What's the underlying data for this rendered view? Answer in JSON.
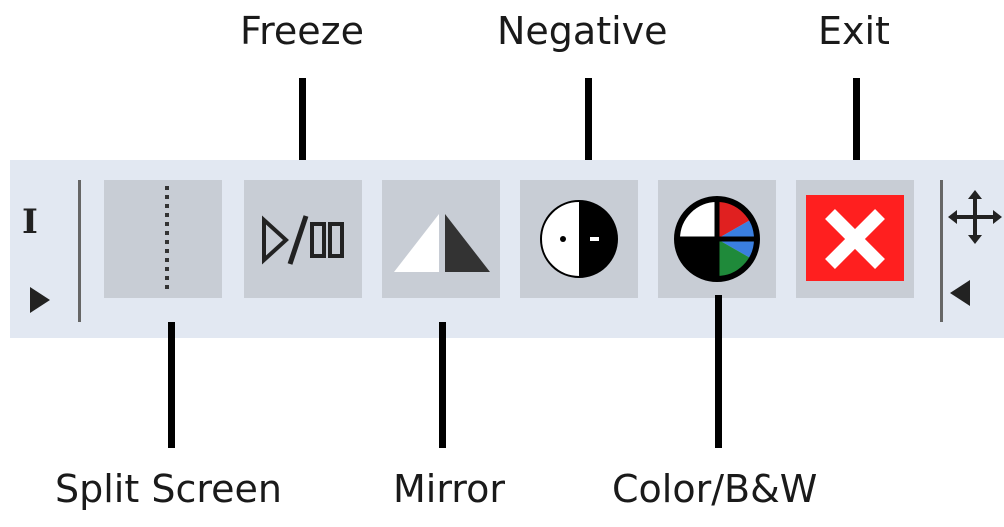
{
  "labels": {
    "freeze": "Freeze",
    "negative": "Negative",
    "exit": "Exit",
    "split_screen": "Split Screen",
    "mirror": "Mirror",
    "color_bw": "Color/B&W"
  },
  "toolbar": {
    "background": "#e2e8f2",
    "button_background": "#c8cdd5",
    "buttons": [
      {
        "id": "split-screen",
        "icon": "split-line-icon"
      },
      {
        "id": "freeze",
        "icon": "play-pause-icon"
      },
      {
        "id": "mirror",
        "icon": "mirror-triangles-icon"
      },
      {
        "id": "negative",
        "icon": "negative-circle-icon"
      },
      {
        "id": "color-bw",
        "icon": "color-wheel-icon"
      },
      {
        "id": "exit",
        "icon": "close-x-icon",
        "color": "#ff1f1f"
      }
    ]
  },
  "colors": {
    "red": "#e02020",
    "blue": "#3a7fe0",
    "green": "#1f8a3a"
  }
}
